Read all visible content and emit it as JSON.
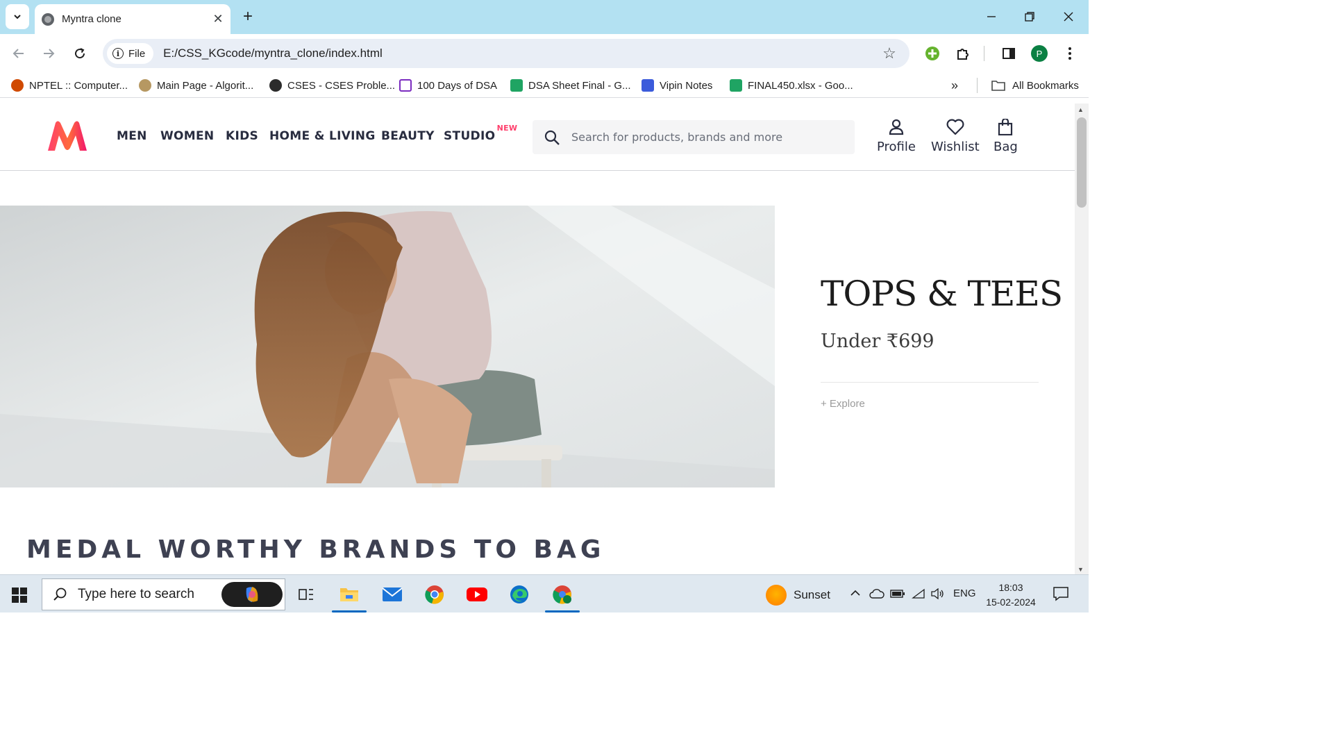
{
  "browser": {
    "tab_title": "Myntra clone",
    "url_chip": "File",
    "url": "E:/CSS_KGcode/myntra_clone/index.html",
    "profile_initial": "P",
    "bookmarks": [
      {
        "label": "NPTEL :: Computer...",
        "icon": "nptel-icon",
        "color": "#d04a02"
      },
      {
        "label": "Main Page - Algorit...",
        "icon": "algorithmica-icon",
        "color": "#8a6d3b"
      },
      {
        "label": "CSES - CSES Proble...",
        "icon": "cses-icon",
        "color": "#2b2b2b"
      },
      {
        "label": "100 Days of DSA",
        "icon": "presentation-icon",
        "color": "#7b2cbf"
      },
      {
        "label": "DSA Sheet Final - G...",
        "icon": "sheets-icon",
        "color": "#1fa463"
      },
      {
        "label": "Vipin Notes",
        "icon": "notes-icon",
        "color": "#3b5bdb"
      },
      {
        "label": "FINAL450.xlsx - Goo...",
        "icon": "sheets-icon",
        "color": "#1fa463"
      }
    ],
    "all_bookmarks": "All Bookmarks"
  },
  "site": {
    "brand_colors": {
      "pink": "#ff3f6c",
      "orange": "#f97b2b"
    },
    "nav": [
      {
        "label": "MEN"
      },
      {
        "label": "WOMEN"
      },
      {
        "label": "KIDS"
      },
      {
        "label": "HOME & LIVING"
      },
      {
        "label": "BEAUTY"
      },
      {
        "label": "STUDIO",
        "badge": "NEW"
      }
    ],
    "search_placeholder": "Search for products, brands and more",
    "actions": [
      {
        "label": "Profile",
        "icon": "person-icon"
      },
      {
        "label": "Wishlist",
        "icon": "heart-icon"
      },
      {
        "label": "Bag",
        "icon": "bag-icon"
      }
    ],
    "hero": {
      "title": "TOPS & TEES",
      "subtitle": "Under ₹699",
      "cta": "+ Explore"
    },
    "section_title": "MEDAL WORTHY BRANDS TO BAG"
  },
  "taskbar": {
    "search_text": "Type here to search",
    "weather": "Sunset",
    "language": "ENG",
    "time": "18:03",
    "date": "15-02-2024"
  }
}
